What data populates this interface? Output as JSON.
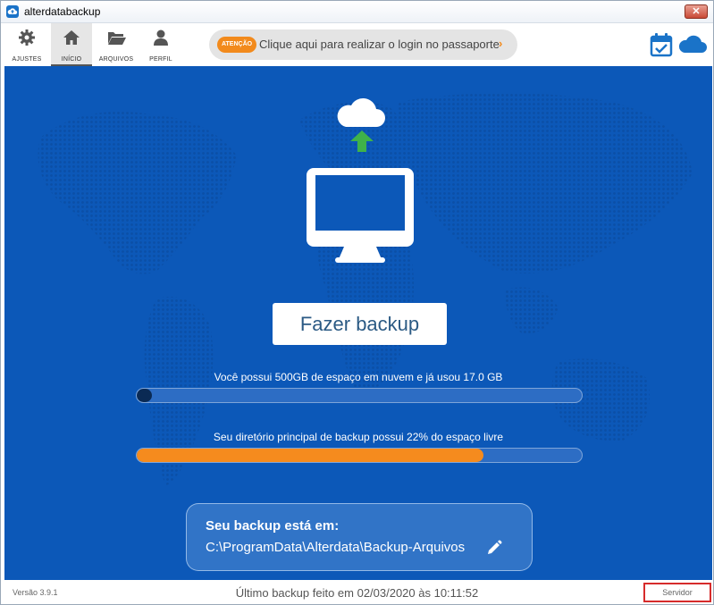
{
  "window": {
    "title": "alterdatabackup",
    "close_glyph": "✕"
  },
  "nav": [
    {
      "label": "AJUSTES",
      "icon": "gear-icon"
    },
    {
      "label": "INÍCIO",
      "icon": "home-icon"
    },
    {
      "label": "ARQUIVOS",
      "icon": "folder-icon"
    },
    {
      "label": "PERFIL",
      "icon": "user-icon"
    }
  ],
  "alert": {
    "badge": "ATENÇÃO",
    "text": "Clique aqui para realizar o login no passaporte",
    "arrow": "›"
  },
  "main": {
    "backup_button": "Fazer backup",
    "quota_text": "Você possui 500GB de espaço em nuvem e já usou 17.0 GB",
    "quota_used_fraction": 0.034,
    "disk_text": "Seu diretório principal de backup possui 22% do espaço livre",
    "disk_used_fraction": 0.78,
    "path_label": "Seu backup está em:",
    "path_value": "C:\\ProgramData\\Alterdata\\Backup-Arquivos"
  },
  "footer": {
    "version": "Versão 3.9.1",
    "last_backup": "Último backup feito em 02/03/2020 às 10:11:52",
    "server_button": "Servidor"
  },
  "colors": {
    "main_blue": "#0c58b8",
    "accent_orange": "#f58b1e",
    "upload_arrow": "#3fb24a"
  }
}
